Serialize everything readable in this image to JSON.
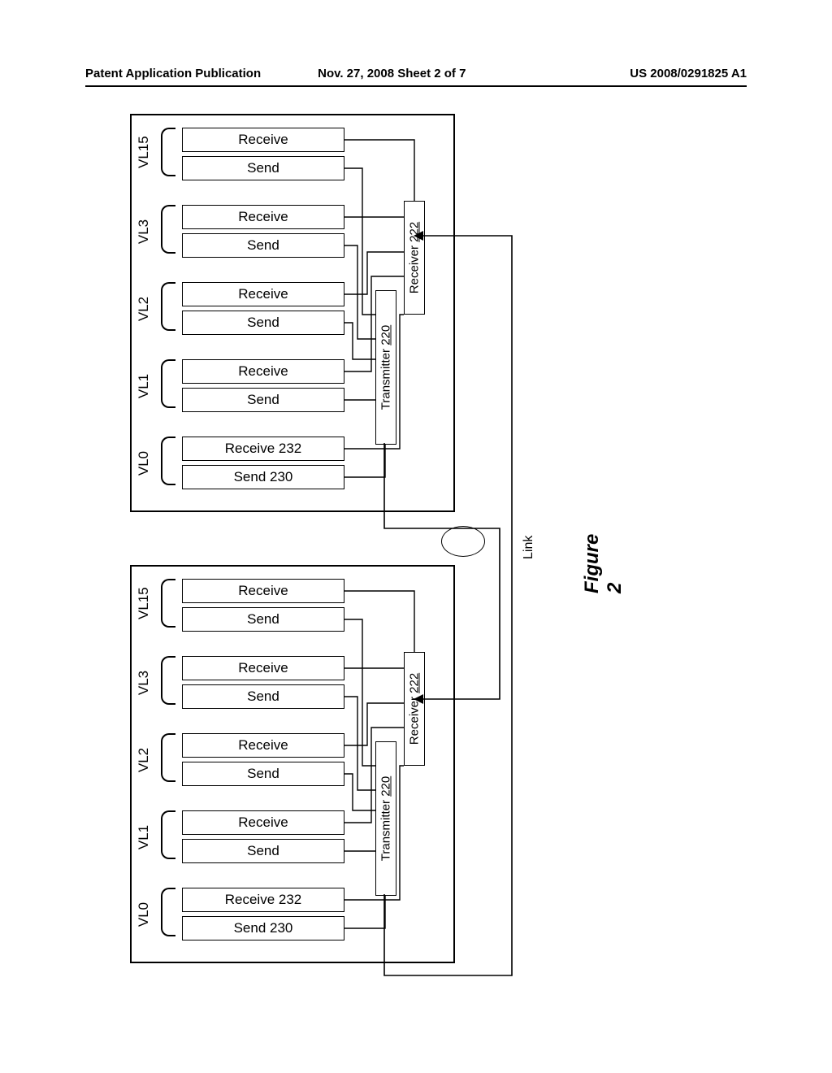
{
  "header": {
    "left": "Patent Application Publication",
    "center": "Nov. 27, 2008  Sheet 2 of 7",
    "right": "US 2008/0291825 A1"
  },
  "figure_label": "Figure 2",
  "link_label": "Link",
  "vl_lanes": [
    "VL15",
    "VL3",
    "VL2",
    "VL1",
    "VL0"
  ],
  "box_labels": {
    "receive": "Receive",
    "send": "Send",
    "receive0": "Receive  232",
    "send0": "Send  230"
  },
  "transmitter": {
    "label": "Transmitter",
    "ref": "220"
  },
  "receiver": {
    "label": "Receiver",
    "ref": "222"
  }
}
